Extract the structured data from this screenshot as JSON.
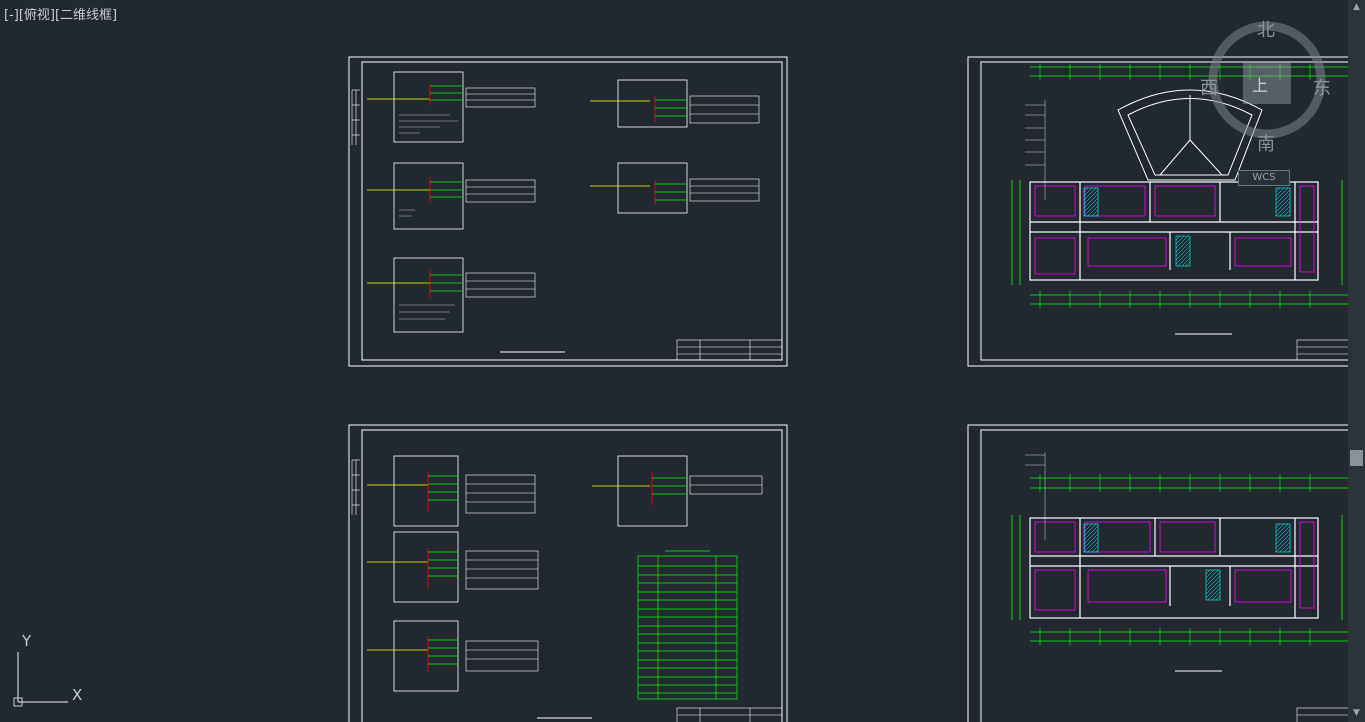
{
  "viewport": {
    "label": "[-][俯视][二维线框]"
  },
  "viewcube": {
    "north": "北",
    "south": "南",
    "east": "东",
    "west": "西",
    "center": "上",
    "wcs": "WCS"
  },
  "ucs_icon": {
    "y_axis": "Y",
    "x_axis": "X"
  },
  "colors": {
    "background": "#212830",
    "sheet_border": "#ffffff",
    "line_yellow": "#ffff00",
    "line_green": "#00ff00",
    "line_red": "#ff0000",
    "line_magenta": "#ff00ff",
    "line_cyan": "#00ffff"
  },
  "scrollbar": {
    "up": "▲",
    "down": "▼"
  }
}
